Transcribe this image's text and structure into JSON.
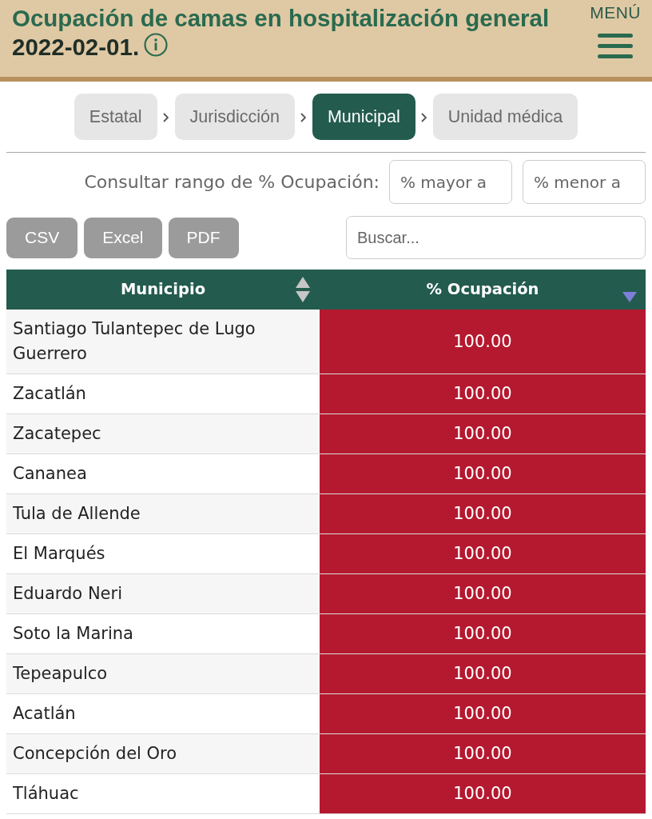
{
  "header": {
    "title": "Ocupación de camas en hospitalización general",
    "date": "2022-02-01.",
    "menu_label": "MENÚ"
  },
  "breadcrumb": [
    {
      "label": "Estatal",
      "selected": false
    },
    {
      "label": "Jurisdicción",
      "selected": false
    },
    {
      "label": "Municipal",
      "selected": true
    },
    {
      "label": "Unidad médica",
      "selected": false
    }
  ],
  "range_filter": {
    "label": "Consultar rango de % Ocupación:",
    "min_placeholder": "% mayor a",
    "max_placeholder": "% menor a"
  },
  "export_buttons": [
    "CSV",
    "Excel",
    "PDF"
  ],
  "search": {
    "placeholder": "Buscar..."
  },
  "table": {
    "columns": [
      {
        "label": "Municipio",
        "sorted": false
      },
      {
        "label": "% Ocupación",
        "sorted": true
      }
    ],
    "rows": [
      [
        "Santiago Tulantepec de Lugo Guerrero",
        "100.00"
      ],
      [
        "Zacatlán",
        "100.00"
      ],
      [
        "Zacatepec",
        "100.00"
      ],
      [
        "Cananea",
        "100.00"
      ],
      [
        "Tula de Allende",
        "100.00"
      ],
      [
        "El Marqués",
        "100.00"
      ],
      [
        "Eduardo Neri",
        "100.00"
      ],
      [
        "Soto la Marina",
        "100.00"
      ],
      [
        "Tepeapulco",
        "100.00"
      ],
      [
        "Acatlán",
        "100.00"
      ],
      [
        "Concepción del Oro",
        "100.00"
      ],
      [
        "Tláhuac",
        "100.00"
      ]
    ]
  }
}
